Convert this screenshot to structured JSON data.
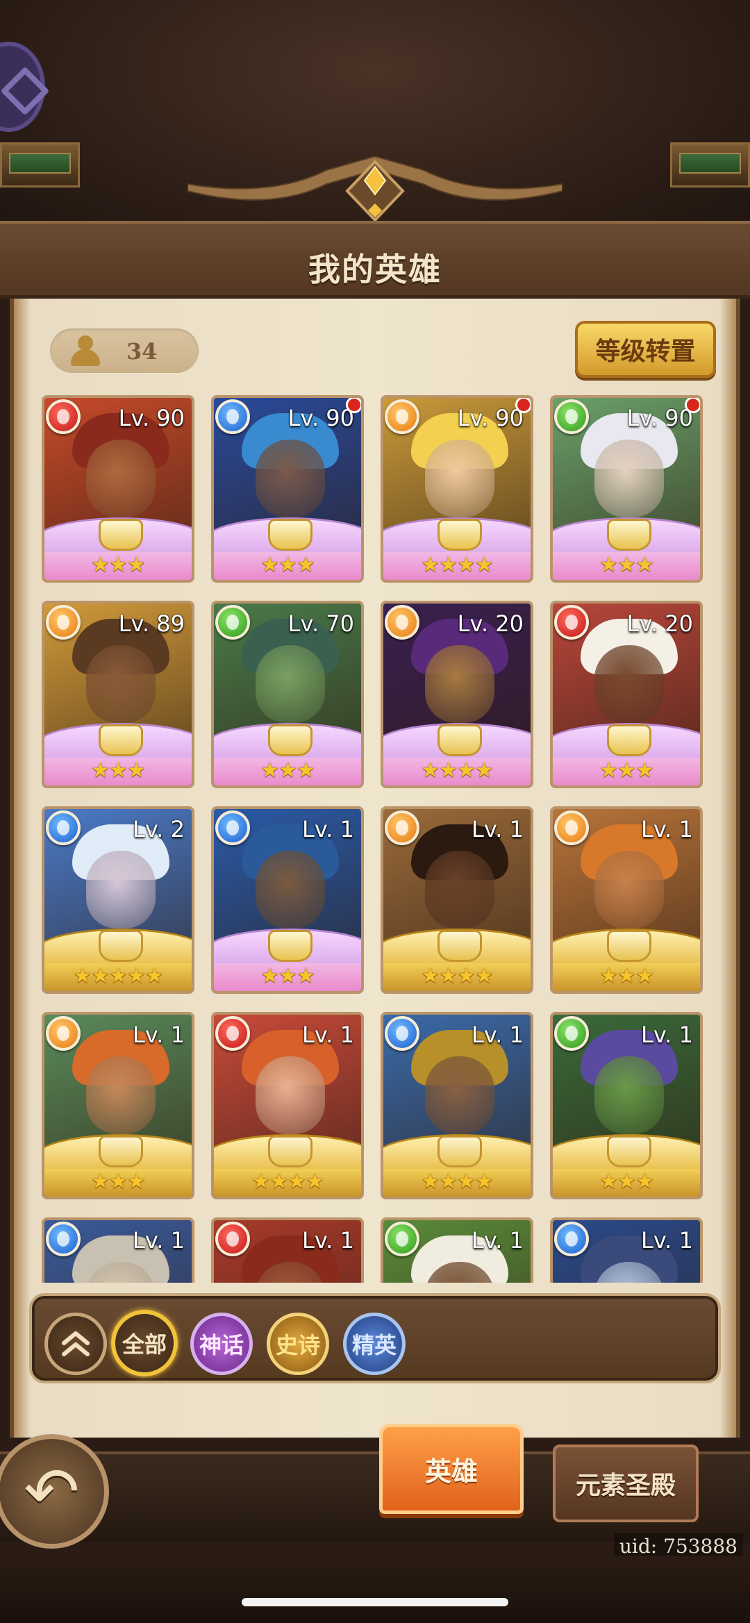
{
  "header": {
    "title": "我的英雄"
  },
  "toolbar": {
    "hero_count": "34",
    "level_reset_label": "等级转置"
  },
  "elements": {
    "fire": "#d22a1e",
    "water": "#2f7de0",
    "light": "#f0921a",
    "wind": "#3ab02a"
  },
  "heroes": [
    {
      "level": "Lv. 90",
      "element": "fire",
      "tier": "myth",
      "stars": "★★★",
      "new": false,
      "skin": "#b0683e",
      "hair": "#8a2a1c",
      "bg": "#c64a2a"
    },
    {
      "level": "Lv. 90",
      "element": "water",
      "tier": "myth",
      "stars": "★★★",
      "new": true,
      "skin": "#7b5a4a",
      "hair": "#3a8ad0",
      "bg": "#2a4a9a"
    },
    {
      "level": "Lv. 90",
      "element": "light",
      "tier": "myth",
      "stars": "★★★★",
      "new": true,
      "skin": "#f2c9a0",
      "hair": "#f4d050",
      "bg": "#c99a3a"
    },
    {
      "level": "Lv. 90",
      "element": "wind",
      "tier": "myth",
      "stars": "★★★",
      "new": true,
      "skin": "#e6d2c0",
      "hair": "#e8e8f0",
      "bg": "#6aa06a"
    },
    {
      "level": "Lv. 89",
      "element": "light",
      "tier": "myth",
      "stars": "★★★",
      "new": false,
      "skin": "#8a5a38",
      "hair": "#5a3a20",
      "bg": "#d09a3a"
    },
    {
      "level": "Lv. 70",
      "element": "wind",
      "tier": "myth",
      "stars": "★★★",
      "new": false,
      "skin": "#7aa060",
      "hair": "#3a6050",
      "bg": "#4a7a4a"
    },
    {
      "level": "Lv. 20",
      "element": "light",
      "tier": "myth",
      "stars": "★★★★",
      "new": false,
      "skin": "#a87a40",
      "hair": "#5a2a7a",
      "bg": "#3a2050"
    },
    {
      "level": "Lv. 20",
      "element": "fire",
      "tier": "myth",
      "stars": "★★★",
      "new": false,
      "skin": "#7a4a2e",
      "hair": "#f4f0e6",
      "bg": "#b8463a"
    },
    {
      "level": "Lv. 2",
      "element": "water",
      "tier": "epic",
      "stars": "★★★★★",
      "new": false,
      "skin": "#d8c8d8",
      "hair": "#e0ecf8",
      "bg": "#4a7ac8"
    },
    {
      "level": "Lv. 1",
      "element": "water",
      "tier": "myth",
      "stars": "★★★",
      "new": false,
      "skin": "#7a5a40",
      "hair": "#2a5a9a",
      "bg": "#2a5aa8"
    },
    {
      "level": "Lv. 1",
      "element": "light",
      "tier": "epic",
      "stars": "★★★★",
      "new": false,
      "skin": "#6a4028",
      "hair": "#2a1a10",
      "bg": "#9a6a3a"
    },
    {
      "level": "Lv. 1",
      "element": "light",
      "tier": "epic",
      "stars": "★★★",
      "new": false,
      "skin": "#c8804a",
      "hair": "#d8782a",
      "bg": "#b8743a"
    },
    {
      "level": "Lv. 1",
      "element": "light",
      "tier": "epic",
      "stars": "★★★",
      "new": false,
      "skin": "#c8885a",
      "hair": "#d86a2a",
      "bg": "#5a8a5a"
    },
    {
      "level": "Lv. 1",
      "element": "fire",
      "tier": "epic",
      "stars": "★★★★",
      "new": false,
      "skin": "#e8b090",
      "hair": "#d8602a",
      "bg": "#c84a3a"
    },
    {
      "level": "Lv. 1",
      "element": "water",
      "tier": "epic",
      "stars": "★★★★",
      "new": false,
      "skin": "#8a6040",
      "hair": "#b8902a",
      "bg": "#3a6aa8"
    },
    {
      "level": "Lv. 1",
      "element": "wind",
      "tier": "epic",
      "stars": "★★★",
      "new": false,
      "skin": "#6a9a48",
      "hair": "#5a4aa0",
      "bg": "#3a6a3a"
    },
    {
      "level": "Lv. 1",
      "element": "water",
      "tier": "epic",
      "stars": "",
      "new": false,
      "skin": "#d8c8b0",
      "hair": "#c8c0b0",
      "bg": "#3a5a9a"
    },
    {
      "level": "Lv. 1",
      "element": "fire",
      "tier": "epic",
      "stars": "",
      "new": false,
      "skin": "#a05a3a",
      "hair": "#8a2a1a",
      "bg": "#a83a2a"
    },
    {
      "level": "Lv. 1",
      "element": "wind",
      "tier": "epic",
      "stars": "",
      "new": false,
      "skin": "#7a5030",
      "hair": "#f0ece0",
      "bg": "#5a8a3a"
    },
    {
      "level": "Lv. 1",
      "element": "water",
      "tier": "epic",
      "stars": "",
      "new": false,
      "skin": "#b8c8e0",
      "hair": "#3a4a7a",
      "bg": "#2a4a8a"
    }
  ],
  "filters": {
    "all": "全部",
    "myth": "神话",
    "epic": "史诗",
    "elite": "精英"
  },
  "bottom_tabs": {
    "hero": "英雄",
    "temple": "元素圣殿"
  },
  "uid": "uid: 753888"
}
